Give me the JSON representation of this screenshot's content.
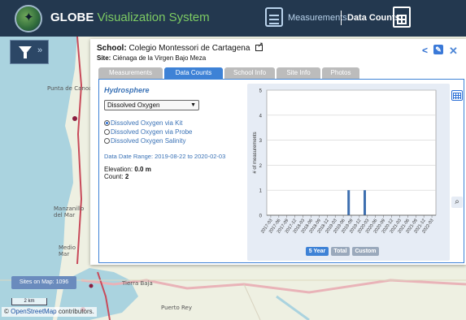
{
  "header": {
    "brand": "GLOBE",
    "brand_accent": "Visualization System",
    "nav_measurements": "Measurements",
    "nav_data_counts": "Data Counts"
  },
  "map": {
    "sites_label": "Sites on Map: 1096",
    "scale_label": "2 km",
    "attribution_prefix": "©",
    "attribution_link": "OpenStreetMap",
    "attribution_suffix": " contributors.",
    "place_labels": [
      "Punta de Canoa",
      "Manzanillo del Mar",
      "Tierra Baja",
      "Puerto Rey",
      "Medio Mar"
    ]
  },
  "panel": {
    "school_label": "School:",
    "school_name": "Colegio Montessori de Cartagena",
    "site_label": "Site:",
    "site_name": "Ciénaga de la Virgen Bajo Meza",
    "tabs": [
      "Measurements",
      "Data Counts",
      "School Info",
      "Site Info",
      "Photos"
    ],
    "active_tab": "Data Counts",
    "section_title": "Hydrosphere",
    "dropdown_value": "Dissolved Oxygen",
    "radio_options": [
      "Dissolved Oxygen via Kit",
      "Dissolved Oxygen via Probe",
      "Dissolved Oxygen Salinity"
    ],
    "selected_radio": 0,
    "date_range": "Data Date Range: 2019-08-22 to 2020-02-03",
    "elevation_label": "Elevation:",
    "elevation_value": "0.0 m",
    "count_label": "Count:",
    "count_value": "2",
    "range_buttons": [
      "5 Year",
      "Total",
      "Custom"
    ],
    "active_range": "5 Year"
  },
  "chart_data": {
    "type": "bar",
    "ylabel": "# of measurements",
    "ylim": [
      0,
      5
    ],
    "yticks": [
      0,
      1,
      2,
      3,
      4,
      5
    ],
    "categories": [
      "2017-03",
      "2017-06",
      "2017-09",
      "2017-12",
      "2018-03",
      "2018-06",
      "2018-09",
      "2018-12",
      "2019-03",
      "2019-06",
      "2019-09",
      "2019-12",
      "2020-03",
      "2020-06",
      "2020-09",
      "2020-12",
      "2021-03",
      "2021-06",
      "2021-09",
      "2021-12",
      "2022-03"
    ],
    "bars": [
      {
        "date": "2019-08",
        "value": 1
      },
      {
        "date": "2020-02",
        "value": 1
      }
    ],
    "colors": {
      "bar": "#3e6fb0",
      "plot_bg": "#ffffff",
      "grid": "#d0d0d0"
    }
  }
}
